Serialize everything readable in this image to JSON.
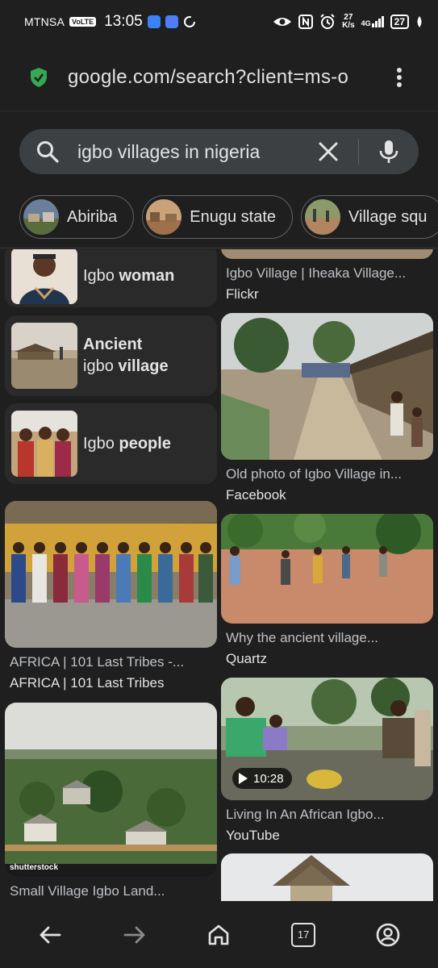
{
  "status_bar": {
    "carrier": "MTNSA",
    "volte": "VoLTE",
    "time": "13:05",
    "net_speed_value": "27",
    "net_speed_unit": "K/s",
    "signal": "4G",
    "battery": "27"
  },
  "url_bar": {
    "url": "google.com/search?client=ms-o",
    "lock_icon": "shield-check-icon",
    "menu_icon": "more-vert-icon"
  },
  "search": {
    "query": "igbo villages in nigeria",
    "clear_icon": "close-icon",
    "mic_icon": "mic-icon"
  },
  "chips": [
    {
      "label": "Abiriba"
    },
    {
      "label": "Enugu state"
    },
    {
      "label": "Village squ"
    }
  ],
  "related": [
    {
      "pre": "Igbo ",
      "bold": "woman",
      "post": ""
    },
    {
      "pre": "",
      "bold": "Ancient",
      "line2_pre": "igbo ",
      "line2_bold": "village"
    },
    {
      "pre": "Igbo ",
      "bold": "people",
      "post": ""
    }
  ],
  "left_cards": [
    {
      "title": "AFRICA | 101 Last Tribes -...",
      "source": "AFRICA | 101 Last Tribes"
    },
    {
      "title": "Small Village Igbo Land...",
      "source": "",
      "watermark": "shutterstock"
    }
  ],
  "right_cards": [
    {
      "title": "Igbo Village | Iheaka Village...",
      "source": "Flickr"
    },
    {
      "title": "Old photo of Igbo Village in...",
      "source": "Facebook"
    },
    {
      "title": "Why the ancient village...",
      "source": "Quartz"
    },
    {
      "title": "Living In An African Igbo...",
      "source": "YouTube",
      "duration": "10:28"
    }
  ],
  "bottom_nav": {
    "tab_count": "17"
  },
  "colors": {
    "background": "#1f1f1f",
    "search_box": "#3c4043",
    "lock_green": "#34a853",
    "text": "#e3e3e3",
    "muted": "#bdc1c6"
  }
}
